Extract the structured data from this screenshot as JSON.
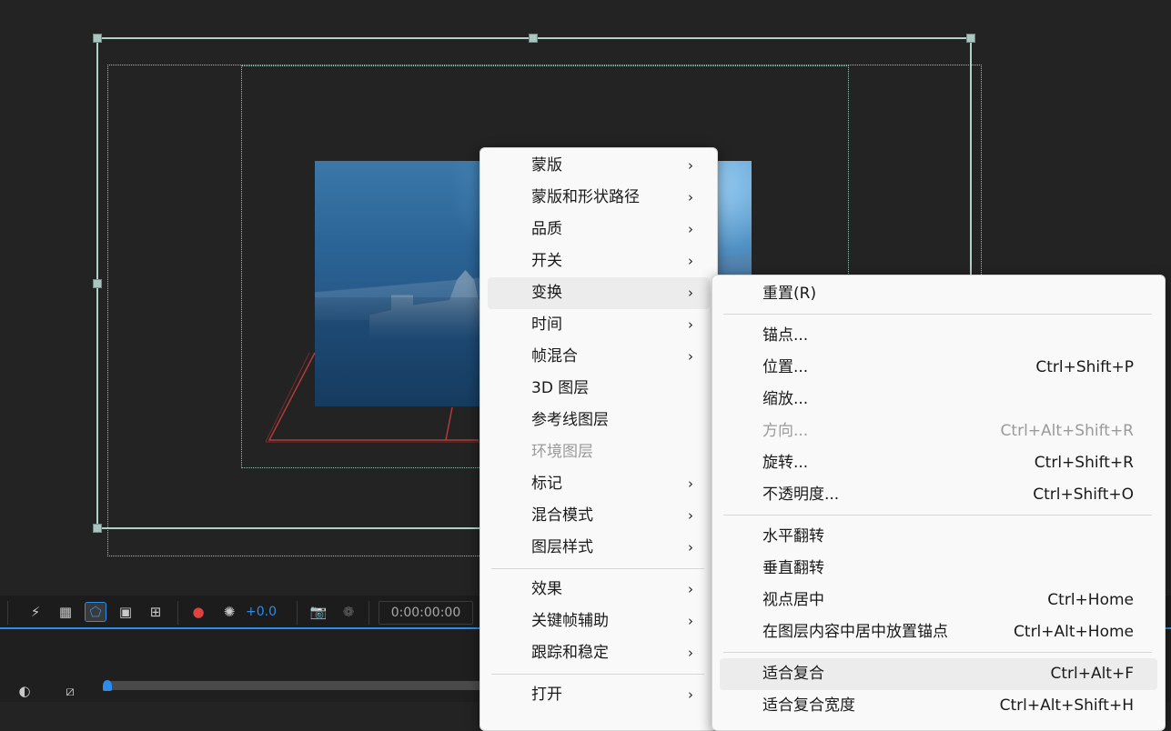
{
  "toolbar": {
    "exposure_value": "+0.0",
    "timecode": "0:00:00:00"
  },
  "layer_menu": {
    "items": [
      {
        "label": "蒙版",
        "submenu": true
      },
      {
        "label": "蒙版和形状路径",
        "submenu": true
      },
      {
        "label": "品质",
        "submenu": true
      },
      {
        "label": "开关",
        "submenu": true
      },
      {
        "label": "变换",
        "submenu": true,
        "highlighted": true
      },
      {
        "label": "时间",
        "submenu": true
      },
      {
        "label": "帧混合",
        "submenu": true
      },
      {
        "label": "3D 图层",
        "submenu": false
      },
      {
        "label": "参考线图层",
        "submenu": false
      },
      {
        "label": "环境图层",
        "submenu": false,
        "disabled": true
      },
      {
        "label": "标记",
        "submenu": true
      },
      {
        "label": "混合模式",
        "submenu": true
      },
      {
        "label": "图层样式",
        "submenu": true
      },
      {
        "label": "效果",
        "submenu": true
      },
      {
        "label": "关键帧辅助",
        "submenu": true
      },
      {
        "label": "跟踪和稳定",
        "submenu": true
      },
      {
        "label": "打开",
        "submenu": true
      }
    ],
    "arrow_glyph": "›"
  },
  "transform_submenu": {
    "items": [
      {
        "label": "重置(R)",
        "shortcut": ""
      },
      {
        "label": "锚点...",
        "shortcut": ""
      },
      {
        "label": "位置...",
        "shortcut": "Ctrl+Shift+P"
      },
      {
        "label": "缩放...",
        "shortcut": ""
      },
      {
        "label": "方向...",
        "shortcut": "Ctrl+Alt+Shift+R",
        "disabled": true
      },
      {
        "label": "旋转...",
        "shortcut": "Ctrl+Shift+R"
      },
      {
        "label": "不透明度...",
        "shortcut": "Ctrl+Shift+O"
      },
      {
        "label": "水平翻转",
        "shortcut": ""
      },
      {
        "label": "垂直翻转",
        "shortcut": ""
      },
      {
        "label": "视点居中",
        "shortcut": "Ctrl+Home"
      },
      {
        "label": "在图层内容中居中放置锚点",
        "shortcut": "Ctrl+Alt+Home"
      },
      {
        "label": "适合复合",
        "shortcut": "Ctrl+Alt+F",
        "highlighted": true
      },
      {
        "label": "适合复合宽度",
        "shortcut": "Ctrl+Alt+Shift+H"
      }
    ]
  },
  "colors": {
    "accent": "#2d8ceb",
    "viewer_bg": "#232323",
    "menu_bg": "#f9f9f9",
    "menu_highlight": "#ececec",
    "disabled_text": "#9a9a9a",
    "bounding_box": "#b3d0c8",
    "camera_outline": "#b33a3a"
  }
}
